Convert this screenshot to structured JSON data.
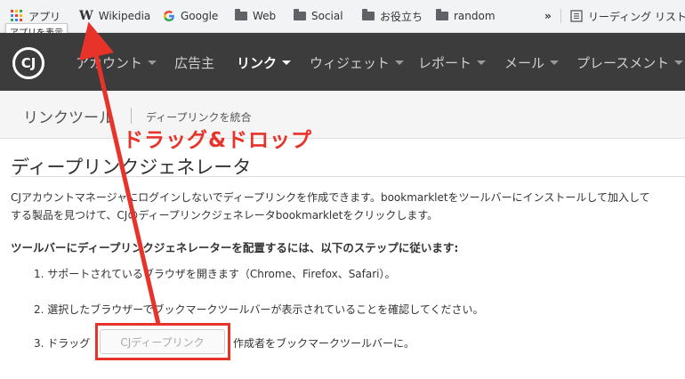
{
  "bookmarks": {
    "apps_label": "アプリ",
    "tooltip": "アプリを表示",
    "items": [
      {
        "icon": "wikipedia-icon",
        "label": "Wikipedia"
      },
      {
        "icon": "google-icon",
        "label": "Google"
      },
      {
        "icon": "folder-icon",
        "label": "Web"
      },
      {
        "icon": "folder-icon",
        "label": "Social"
      },
      {
        "icon": "folder-icon",
        "label": "お役立ち"
      },
      {
        "icon": "folder-icon",
        "label": "random"
      }
    ],
    "overflow": "»",
    "reading_list": "リーディング リスト"
  },
  "nav": {
    "logo_text": "CJ",
    "items": [
      {
        "label": "アカウント"
      },
      {
        "label": "広告主"
      },
      {
        "label": "リンク"
      },
      {
        "label": "ウィジェット"
      },
      {
        "label": "レポート"
      },
      {
        "label": "メール"
      },
      {
        "label": "プレースメント"
      }
    ]
  },
  "subbar": {
    "title": "リンクツール",
    "link": "ディープリンクを統合"
  },
  "overlay": {
    "label": "ドラッグ&ドロップ",
    "accent_color": "#e8332a"
  },
  "main": {
    "heading": "ディープリンクジェネレータ",
    "description_line1": "CJアカウントマネージャにログインしないでディープリンクを作成できます。bookmarkletをツールバーにインストールして加入して",
    "description_line2": "する製品を見つけて、CJのディープリンクジェネレータbookmarkletをクリックします。",
    "steps_heading": "ツールバーにディープリンクジェネレーターを配置するには、以下のステップに従います:",
    "step1": "1. サポートされているブラウザを開きます（Chrome、Firefox、Safari）。",
    "step2": "2. 選択したブラウザーでブックマークツールバーが表示されていることを確認してください。",
    "step3_prefix": "3. ドラッグ",
    "step3_button": "CJディープリンク",
    "step3_suffix": "作成者をブックマークツールバーに。"
  }
}
